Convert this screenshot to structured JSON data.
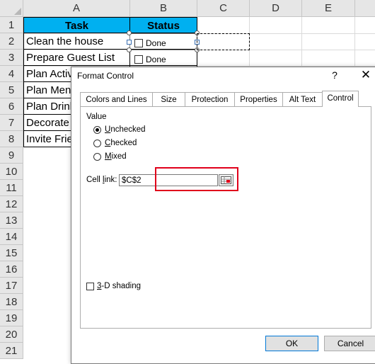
{
  "sheet": {
    "columns": [
      "A",
      "B",
      "C",
      "D",
      "E"
    ],
    "rows": [
      "1",
      "2",
      "3",
      "4",
      "5",
      "6",
      "7",
      "8",
      "9",
      "10",
      "11",
      "12",
      "13",
      "14",
      "15",
      "16",
      "17",
      "18",
      "19",
      "20",
      "21"
    ],
    "header_task": "Task",
    "header_status": "Status",
    "tasks": [
      "Clean the house",
      "Prepare Guest List",
      "Plan Activ",
      "Plan Menu",
      "Plan Drink",
      "Decorate",
      "Invite Frie"
    ],
    "checkbox_labels": [
      "Done",
      "Done"
    ],
    "header_color": "#00b0f0"
  },
  "dialog": {
    "title": "Format Control",
    "help": "?",
    "close": "✕",
    "tabs": [
      "Colors and Lines",
      "Size",
      "Protection",
      "Properties",
      "Alt Text",
      "Control"
    ],
    "active_tab": "Control",
    "value_group": "Value",
    "radio_unchecked_pre": "",
    "radio_unchecked_u": "U",
    "radio_unchecked_post": "nchecked",
    "radio_checked_pre": "",
    "radio_checked_u": "C",
    "radio_checked_post": "hecked",
    "radio_mixed_pre": "",
    "radio_mixed_u": "M",
    "radio_mixed_post": "ixed",
    "selected_radio": "Unchecked",
    "cell_link_pre": "Cell ",
    "cell_link_u": "l",
    "cell_link_post": "ink:",
    "cell_link_value": "$C$2",
    "shading_u": "3",
    "shading_post": "-D shading",
    "ok": "OK",
    "cancel": "Cancel",
    "highlight_color": "#e0001b"
  }
}
